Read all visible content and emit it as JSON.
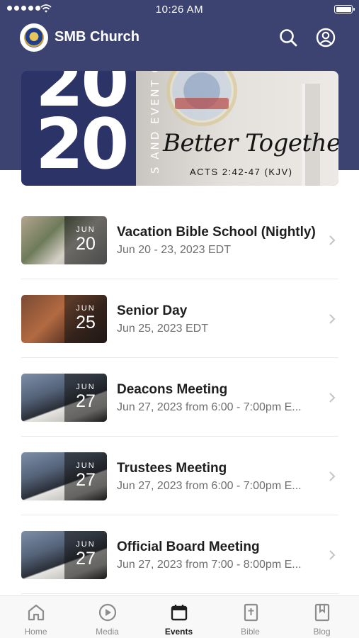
{
  "status_bar": {
    "time": "10:26 AM"
  },
  "header": {
    "title": "SMB Church"
  },
  "banner": {
    "big_number": "20\n20",
    "vertical_text": "S AND EVENT CA",
    "script_title": "Better Together",
    "verse": "ACTS 2:42-47 (KJV)",
    "seal_text": "Baptist Church",
    "seal_est": "EST. 1906"
  },
  "events": [
    {
      "month": "JUN",
      "day": "20",
      "title": "Vacation Bible School (Nightly)",
      "subtitle": "Jun 20 - 23, 2023 EDT"
    },
    {
      "month": "JUN",
      "day": "25",
      "title": "Senior Day",
      "subtitle": "Jun 25, 2023 EDT"
    },
    {
      "month": "JUN",
      "day": "27",
      "title": "Deacons Meeting",
      "subtitle": "Jun 27, 2023 from 6:00 - 7:00pm E..."
    },
    {
      "month": "JUN",
      "day": "27",
      "title": "Trustees Meeting",
      "subtitle": "Jun 27, 2023 from 6:00 - 7:00pm E..."
    },
    {
      "month": "JUN",
      "day": "27",
      "title": "Official Board Meeting",
      "subtitle": "Jun 27, 2023 from 7:00 - 8:00pm E..."
    }
  ],
  "tabs": [
    {
      "label": "Home",
      "icon": "home-icon"
    },
    {
      "label": "Media",
      "icon": "play-icon"
    },
    {
      "label": "Events",
      "icon": "calendar-icon",
      "active": true
    },
    {
      "label": "Bible",
      "icon": "bible-icon"
    },
    {
      "label": "Blog",
      "icon": "book-icon"
    }
  ],
  "colors": {
    "header_bg": "#3d4370",
    "text_primary": "#1e1e1e",
    "text_secondary": "#6e6e6e",
    "tab_inactive": "#8c8c8c"
  }
}
